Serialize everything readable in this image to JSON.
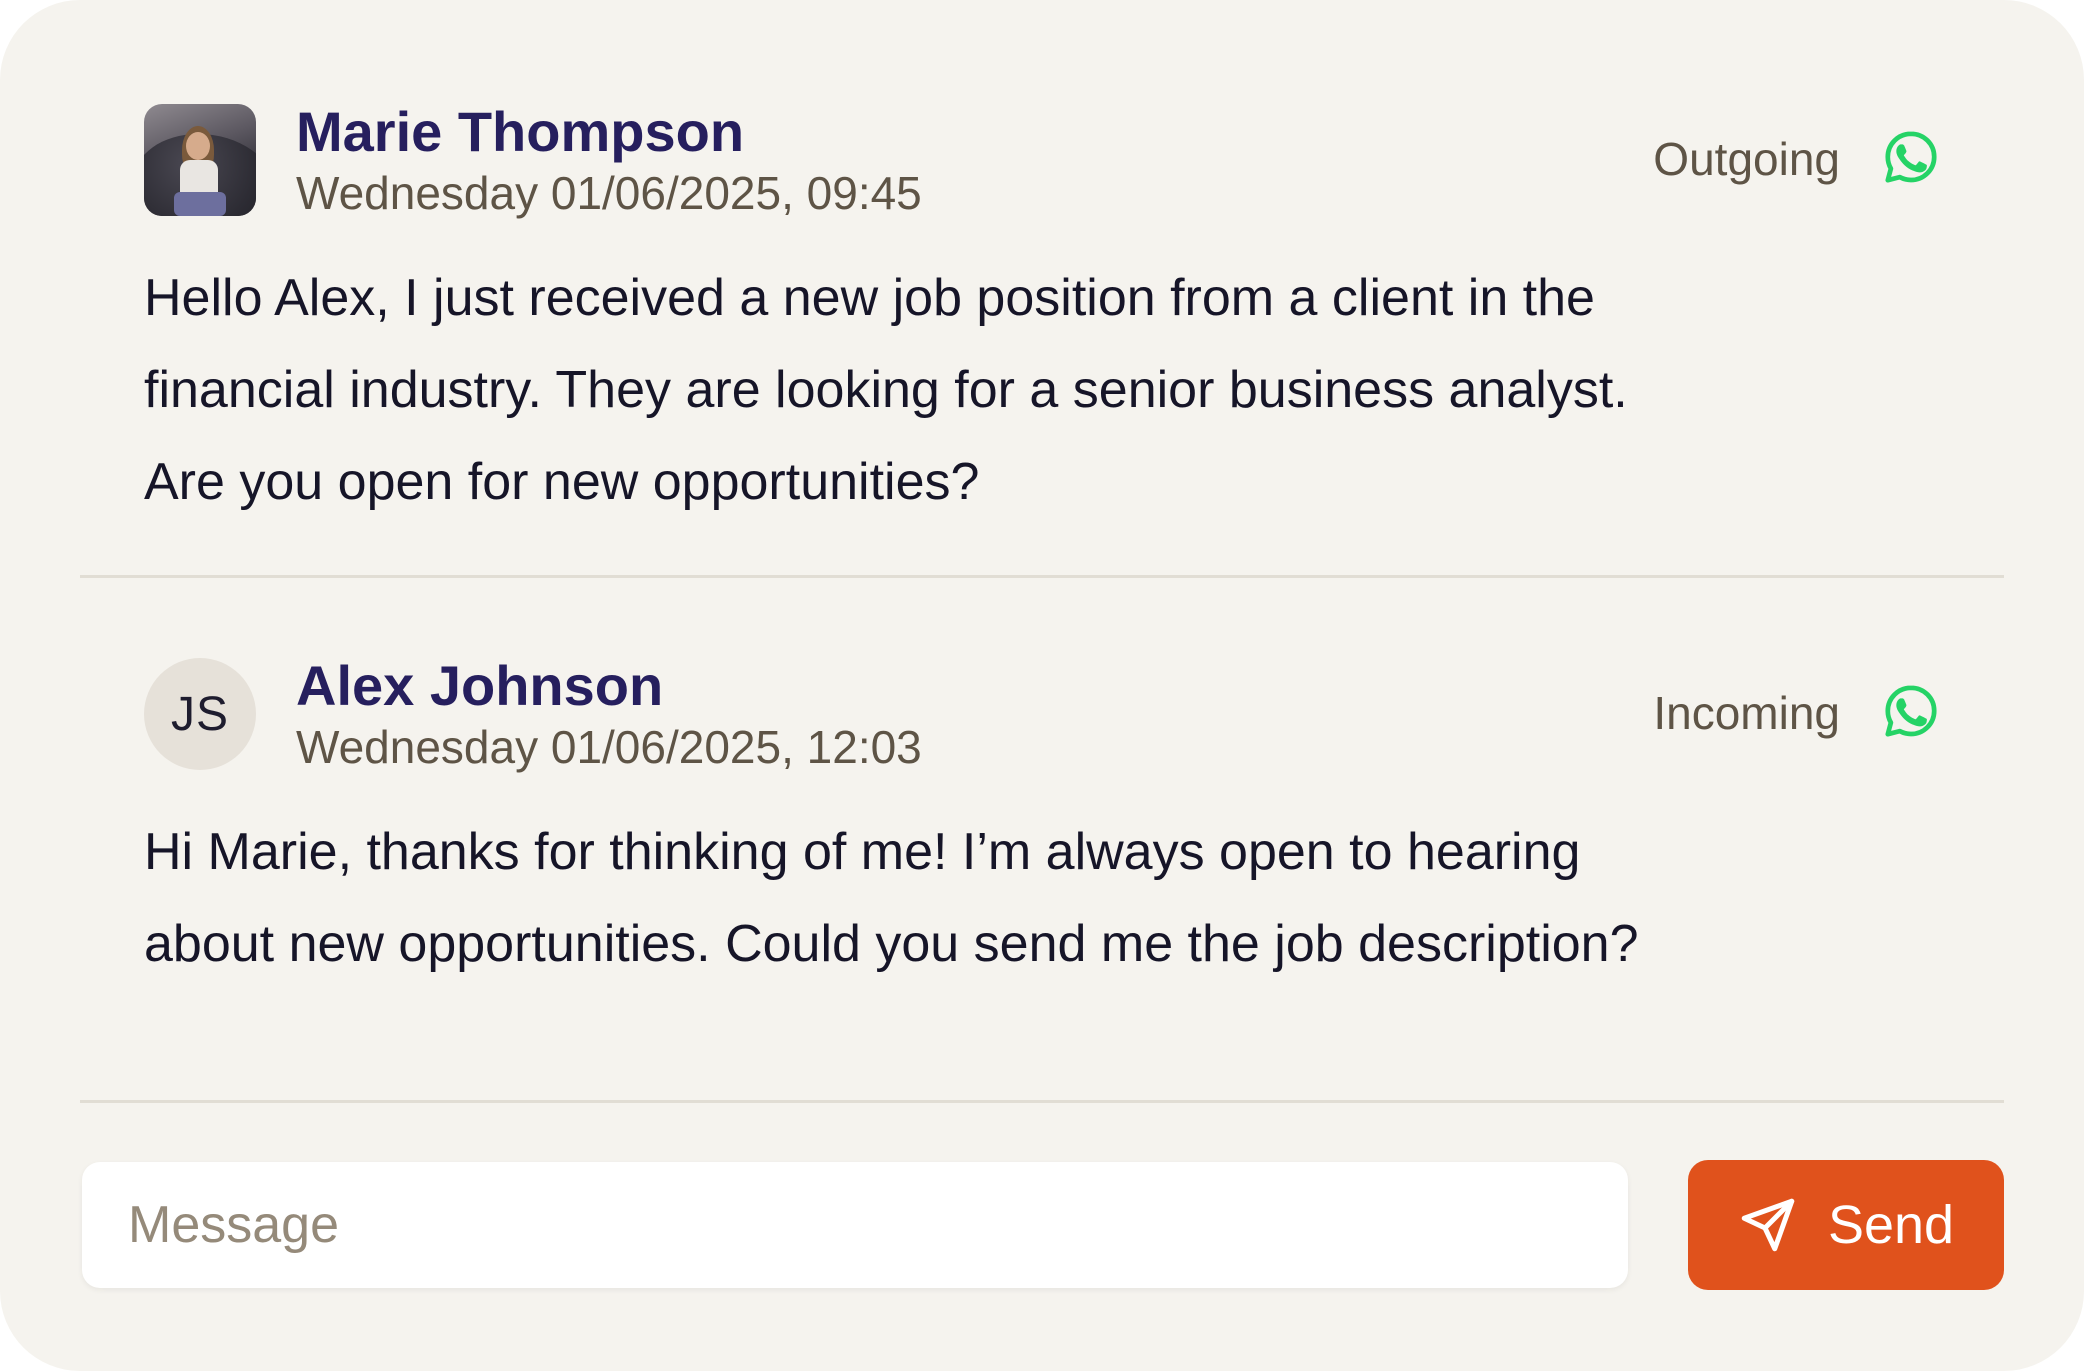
{
  "messages": [
    {
      "sender": "Marie Thompson",
      "timestamp": "Wednesday 01/06/2025, 09:45",
      "direction": "Outgoing",
      "channel_icon": "whatsapp-icon",
      "avatar": "photo",
      "lines": [
        "Hello Alex, I just received a new job position from a client in the",
        "financial industry. They are looking for a senior business analyst.",
        "Are you open for new opportunities?"
      ]
    },
    {
      "sender": "Alex Johnson",
      "timestamp": "Wednesday 01/06/2025, 12:03",
      "direction": "Incoming",
      "channel_icon": "whatsapp-icon",
      "avatar_initials": "JS",
      "lines": [
        "Hi Marie, thanks for thinking of me! I’m always open to hearing",
        "about new opportunities. Could you send me the job description?"
      ]
    }
  ],
  "composer": {
    "placeholder": "Message",
    "value": ""
  },
  "send_button": {
    "label": "Send",
    "icon": "send-icon"
  },
  "colors": {
    "background": "#f5f3ee",
    "name": "#261f5e",
    "meta": "#5e5446",
    "whatsapp": "#25d366",
    "send": "#e0521c"
  }
}
